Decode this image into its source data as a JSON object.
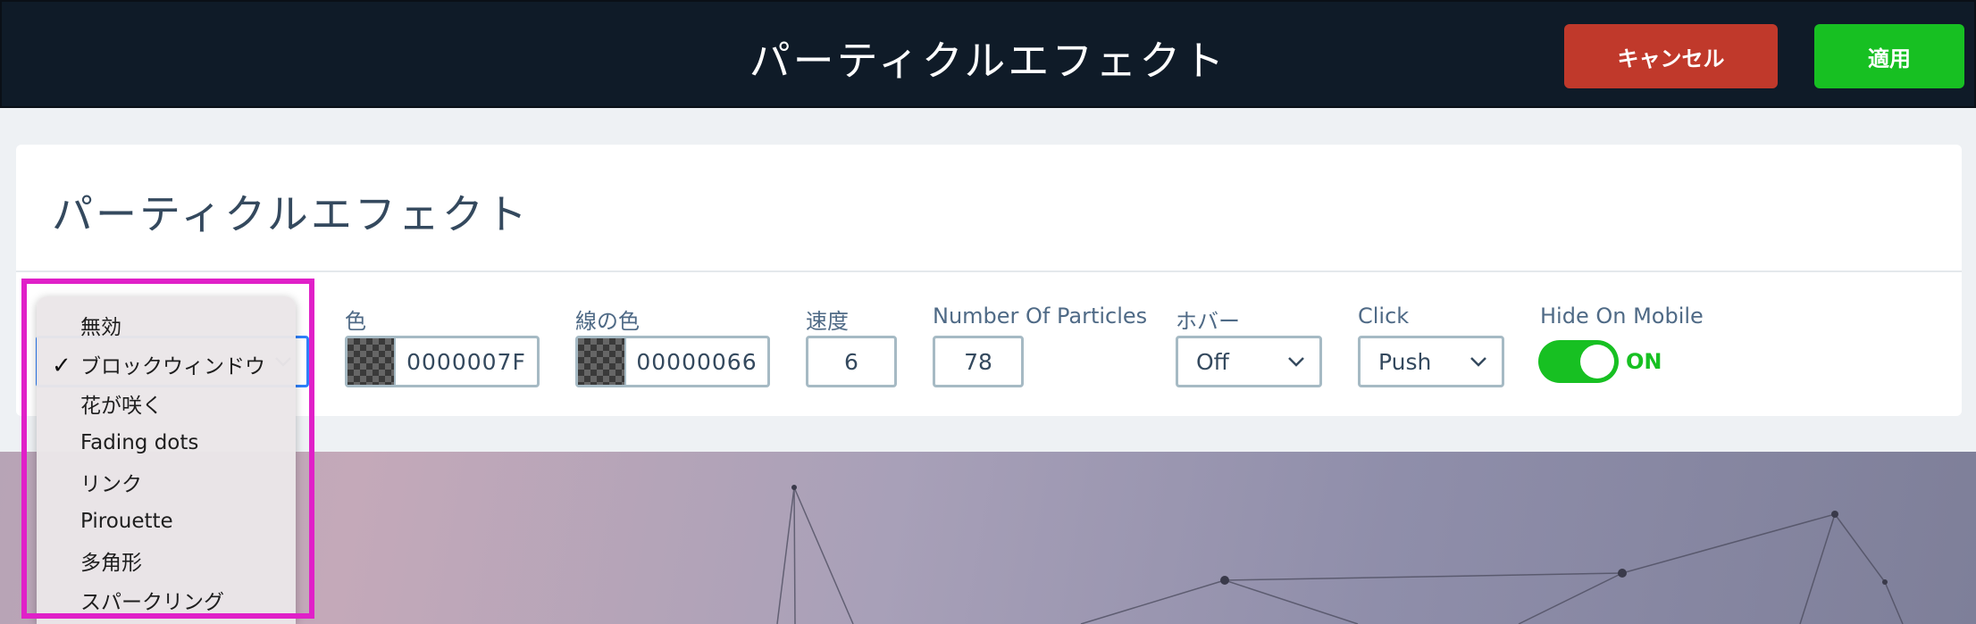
{
  "header": {
    "title": "パーティクルエフェクト",
    "cancel_label": "キャンセル",
    "apply_label": "適用"
  },
  "panel": {
    "title": "パーティクルエフェクト"
  },
  "fields": {
    "color": {
      "label": "色",
      "value": "0000007F"
    },
    "line_color": {
      "label": "線の色",
      "value": "00000066"
    },
    "speed": {
      "label": "速度",
      "value": "6"
    },
    "particles": {
      "label": "Number Of Particles",
      "value": "78"
    },
    "hover": {
      "label": "ホバー",
      "value": "Off"
    },
    "click": {
      "label": "Click",
      "value": "Push"
    },
    "hide_mobile": {
      "label": "Hide On Mobile",
      "state": "ON"
    }
  },
  "dropdown": {
    "items": [
      {
        "label": "無効",
        "checked": false
      },
      {
        "label": "ブロックウィンドウ",
        "checked": true
      },
      {
        "label": "花が咲く",
        "checked": false
      },
      {
        "label": "Fading dots",
        "checked": false
      },
      {
        "label": "リンク",
        "checked": false
      },
      {
        "label": "Pirouette",
        "checked": false
      },
      {
        "label": "多角形",
        "checked": false
      },
      {
        "label": "スパークリング",
        "checked": false
      }
    ],
    "check_glyph": "✓"
  },
  "colors": {
    "header_bg": "#0f1b28",
    "cancel": "#c0392b",
    "apply": "#17c022",
    "toggle_on": "#17c022",
    "highlight": "#e020c8"
  }
}
